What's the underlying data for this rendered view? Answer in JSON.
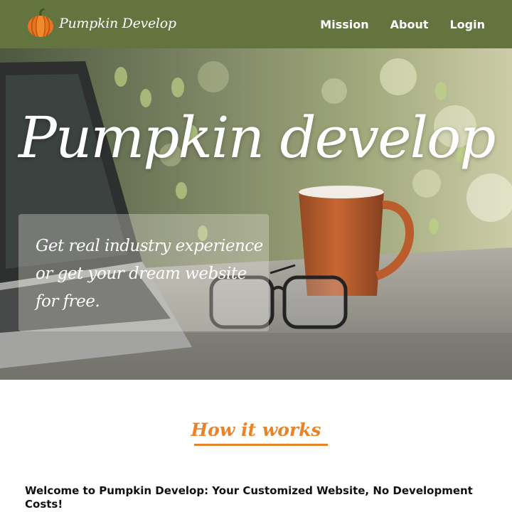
{
  "navbar": {
    "logo_icon": "pumpkin-icon",
    "brand_name": "Pumpkin Develop",
    "links": [
      {
        "label": "Mission"
      },
      {
        "label": "About"
      },
      {
        "label": "Login"
      }
    ],
    "background_color": "#63743f"
  },
  "hero": {
    "title": "Pumpkin develop",
    "tagline": "Get real industry experience or get your dream website for free."
  },
  "how_it_works": {
    "heading": "How it works",
    "accent_color": "#e8832a",
    "intro": "Welcome to Pumpkin Develop: Your Customized Website, No Development Costs!"
  }
}
